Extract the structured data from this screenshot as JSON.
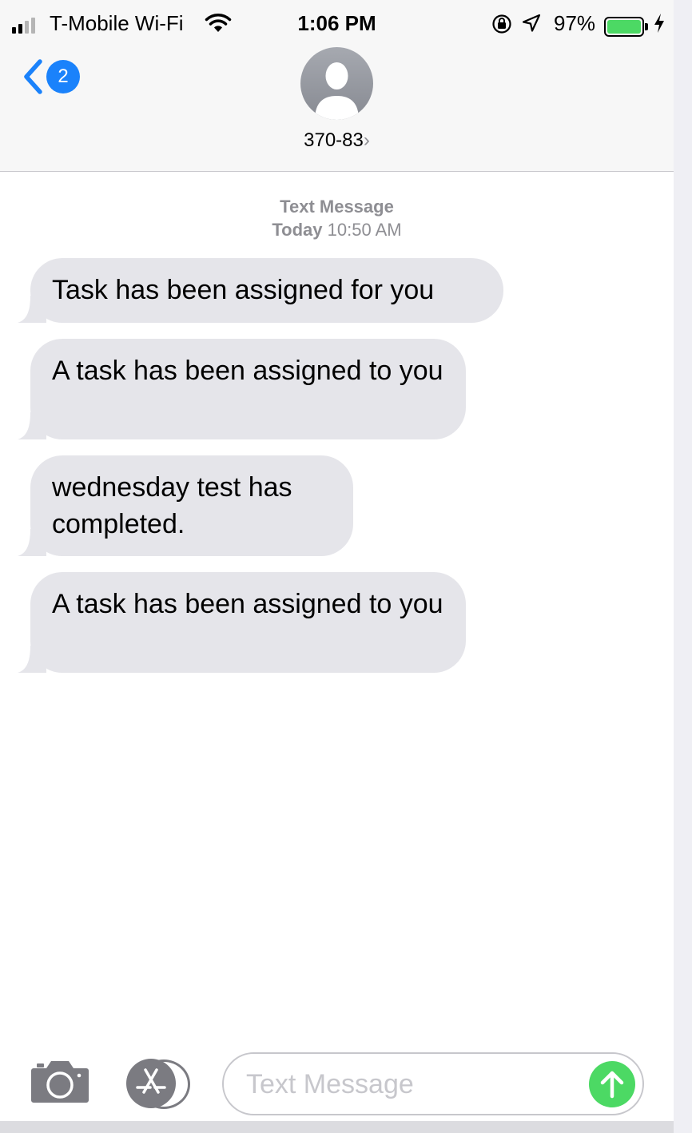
{
  "status_bar": {
    "carrier": "T-Mobile Wi-Fi",
    "time": "1:06 PM",
    "battery_percent": "97%",
    "battery_level": 0.97,
    "signal_bars_active": 2,
    "signal_bars_total": 4,
    "icons": [
      "wifi-icon",
      "rotation-lock-icon",
      "location-arrow-icon",
      "battery-icon",
      "charging-bolt-icon"
    ]
  },
  "nav": {
    "back_badge": "2",
    "contact": "370-83",
    "contact_chevron": "›"
  },
  "conversation": {
    "timestamp_service": "Text Message",
    "timestamp_day": "Today",
    "timestamp_time": "10:50 AM",
    "messages": [
      {
        "text": "Task has been assigned for you",
        "direction": "incoming"
      },
      {
        "text": "A task has been assigned to you",
        "direction": "incoming"
      },
      {
        "text": "wednesday test has completed.",
        "direction": "incoming"
      },
      {
        "text": "A task has been assigned to you",
        "direction": "incoming"
      }
    ]
  },
  "composer": {
    "placeholder": "Text Message",
    "icons": [
      "camera-icon",
      "app-store-icon",
      "send-arrow-icon"
    ]
  },
  "colors": {
    "accent": "#1a82fb",
    "incoming_bubble": "#e5e5ea",
    "send_button": "#4cd964",
    "secondary_text": "#8e8e93"
  }
}
